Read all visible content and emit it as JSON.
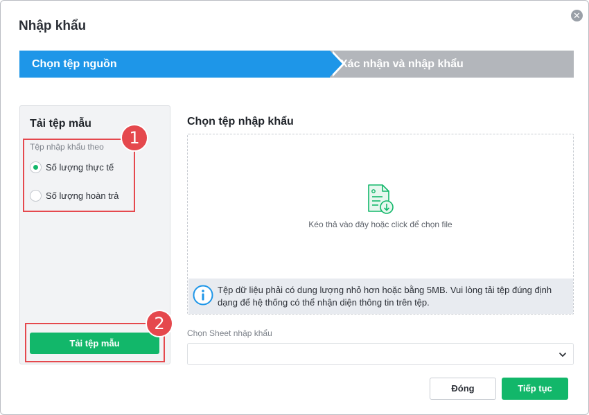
{
  "dialog": {
    "title": "Nhập khẩu",
    "close_icon": "close-icon"
  },
  "stepper": {
    "steps": [
      {
        "label": "Chọn tệp nguồn",
        "active": true
      },
      {
        "label": "Xác nhận và nhập khẩu",
        "active": false
      }
    ],
    "active_color": "#1e96e8",
    "inactive_color": "#b3b6bb"
  },
  "template_panel": {
    "title": "Tải tệp mẫu",
    "group_label": "Tệp nhập khẩu theo",
    "options": [
      {
        "label": "Số lượng thực tế",
        "checked": true
      },
      {
        "label": "Số lượng hoàn trả",
        "checked": false
      }
    ],
    "download_label": "Tải tệp mẫu"
  },
  "annotations": {
    "badge1": "1",
    "badge2": "2",
    "color": "#e5484d"
  },
  "import_file": {
    "title": "Chọn tệp nhập khẩu",
    "drop_text": "Kéo thả vào đây hoặc click để chọn file",
    "file_icon": "file-download-icon",
    "info_icon": "info-icon",
    "info_text": "Tệp dữ liệu phải có dung lượng nhỏ hơn hoặc bằng 5MB. Vui lòng tải tệp đúng định dạng để hệ thống có thể nhận diện thông tin trên tệp."
  },
  "sheet": {
    "label": "Chọn Sheet nhập khẩu",
    "value": "",
    "icon": "chevron-down-icon"
  },
  "footer": {
    "close_label": "Đóng",
    "next_label": "Tiếp tục"
  },
  "colors": {
    "primary_green": "#12b76a"
  }
}
